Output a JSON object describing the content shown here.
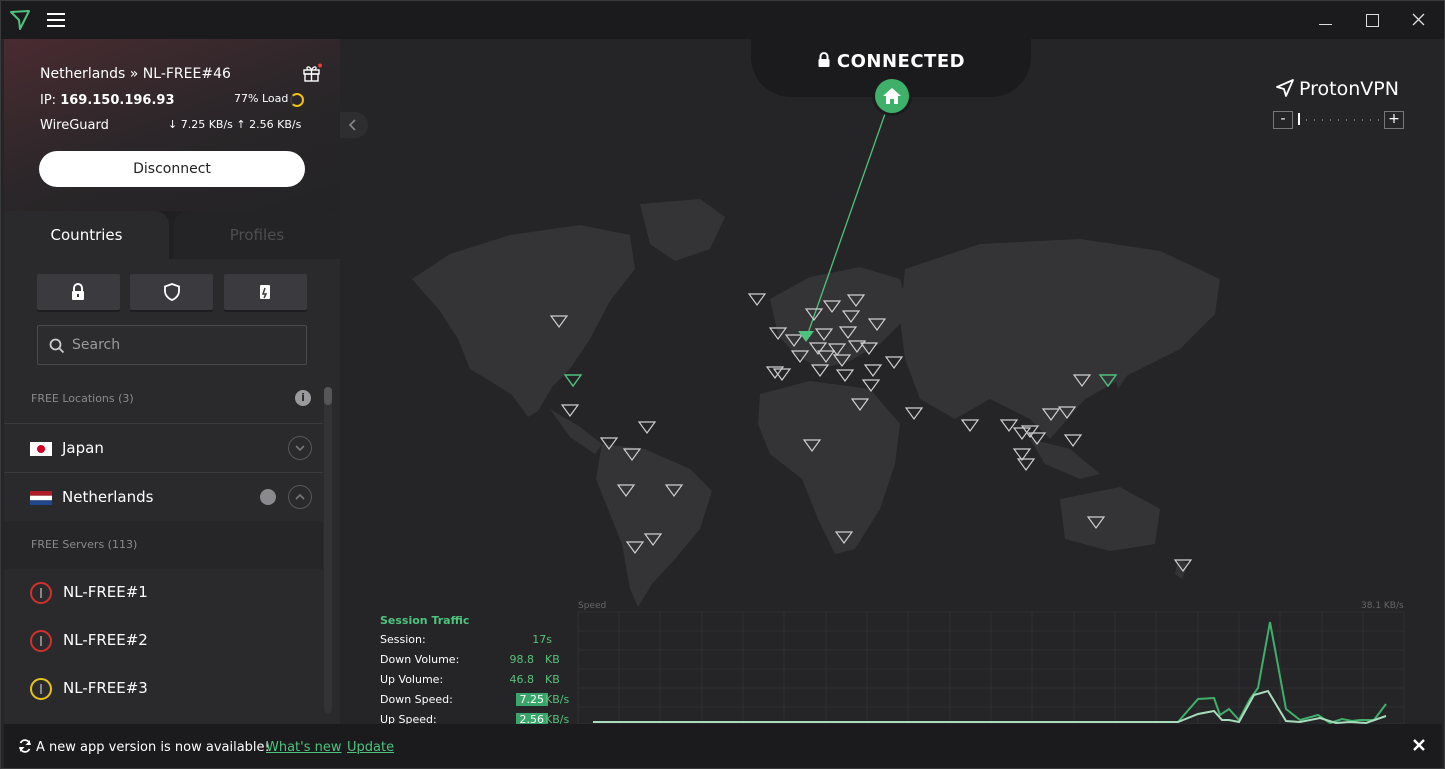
{
  "connection": {
    "location": "Netherlands » NL-FREE#46",
    "ip_label": "IP: ",
    "ip": "169.150.196.93",
    "load": "77% Load",
    "protocol": "WireGuard",
    "down": "7.25 KB/s",
    "up": "2.56 KB/s",
    "disconnect_label": "Disconnect",
    "load_fraction": 0.77
  },
  "tabs": {
    "countries": "Countries",
    "profiles": "Profiles"
  },
  "search": {
    "placeholder": "Search"
  },
  "free_locations_label": "FREE Locations (3)",
  "countries": [
    {
      "name": "Japan"
    },
    {
      "name": "Netherlands"
    }
  ],
  "free_servers_label": "FREE Servers (113)",
  "servers": [
    {
      "name": "NL-FREE#1",
      "status": "red"
    },
    {
      "name": "NL-FREE#2",
      "status": "red"
    },
    {
      "name": "NL-FREE#3",
      "status": "yellow"
    }
  ],
  "map": {
    "status": "CONNECTED",
    "brand": "ProtonVPN",
    "zoom_minus": "-",
    "zoom_plus": "+"
  },
  "traffic": {
    "title": "Session Traffic",
    "session_label": "Session:",
    "session_value": "17s",
    "down_volume_label": "Down Volume:",
    "down_volume_value": "98.8",
    "down_volume_unit": "KB",
    "up_volume_label": "Up Volume:",
    "up_volume_value": "46.8",
    "up_volume_unit": "KB",
    "down_speed_label": "Down Speed:",
    "down_speed_value": "7.25",
    "down_speed_unit": "KB/s",
    "up_speed_label": "Up Speed:",
    "up_speed_value": "2.56",
    "up_speed_unit": "KB/s",
    "chart_label": "Speed",
    "chart_max": "38.1  KB/s"
  },
  "banner": {
    "text": "A new app version is now available!",
    "whats_new": "What's new",
    "update": "Update"
  },
  "colors": {
    "accent": "#4fc27e",
    "danger": "#d0312d",
    "warning": "#e5c41a"
  },
  "icons": [
    "protonvpn-logo-icon",
    "hamburger-menu-icon",
    "gift-icon",
    "lock-icon",
    "shield-icon",
    "tor-icon",
    "search-icon",
    "info-icon",
    "chevron-down-icon",
    "chevron-up-icon",
    "p2p-icon",
    "home-icon",
    "sync-icon",
    "close-icon"
  ]
}
